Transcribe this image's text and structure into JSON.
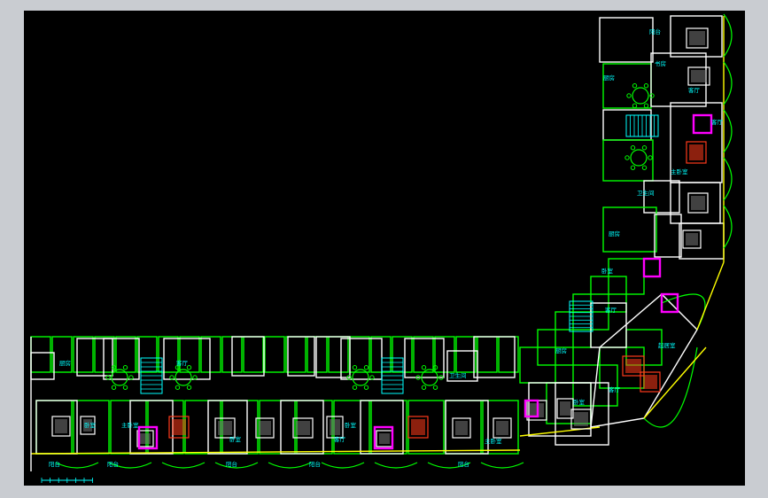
{
  "colors": {
    "background": "#000000",
    "frame": "#c9ccd1",
    "wall_green": "#00ff00",
    "wall_white": "#ffffff",
    "dim_yellow": "#ffff00",
    "label_cyan": "#00ffff",
    "furniture_magenta": "#ff00ff",
    "bed_red": "#ff3a1a"
  },
  "room_labels": {
    "bedroom": "卧室",
    "living": "客厅",
    "dining": "餐厅",
    "kitchen": "厨房",
    "toilet": "卫生间",
    "balcony": "阳台",
    "study": "书房",
    "master_bedroom": "主卧室",
    "lounge": "起居室"
  },
  "cad_ui": {
    "scale_bar_icon": "scale-bar-icon"
  }
}
